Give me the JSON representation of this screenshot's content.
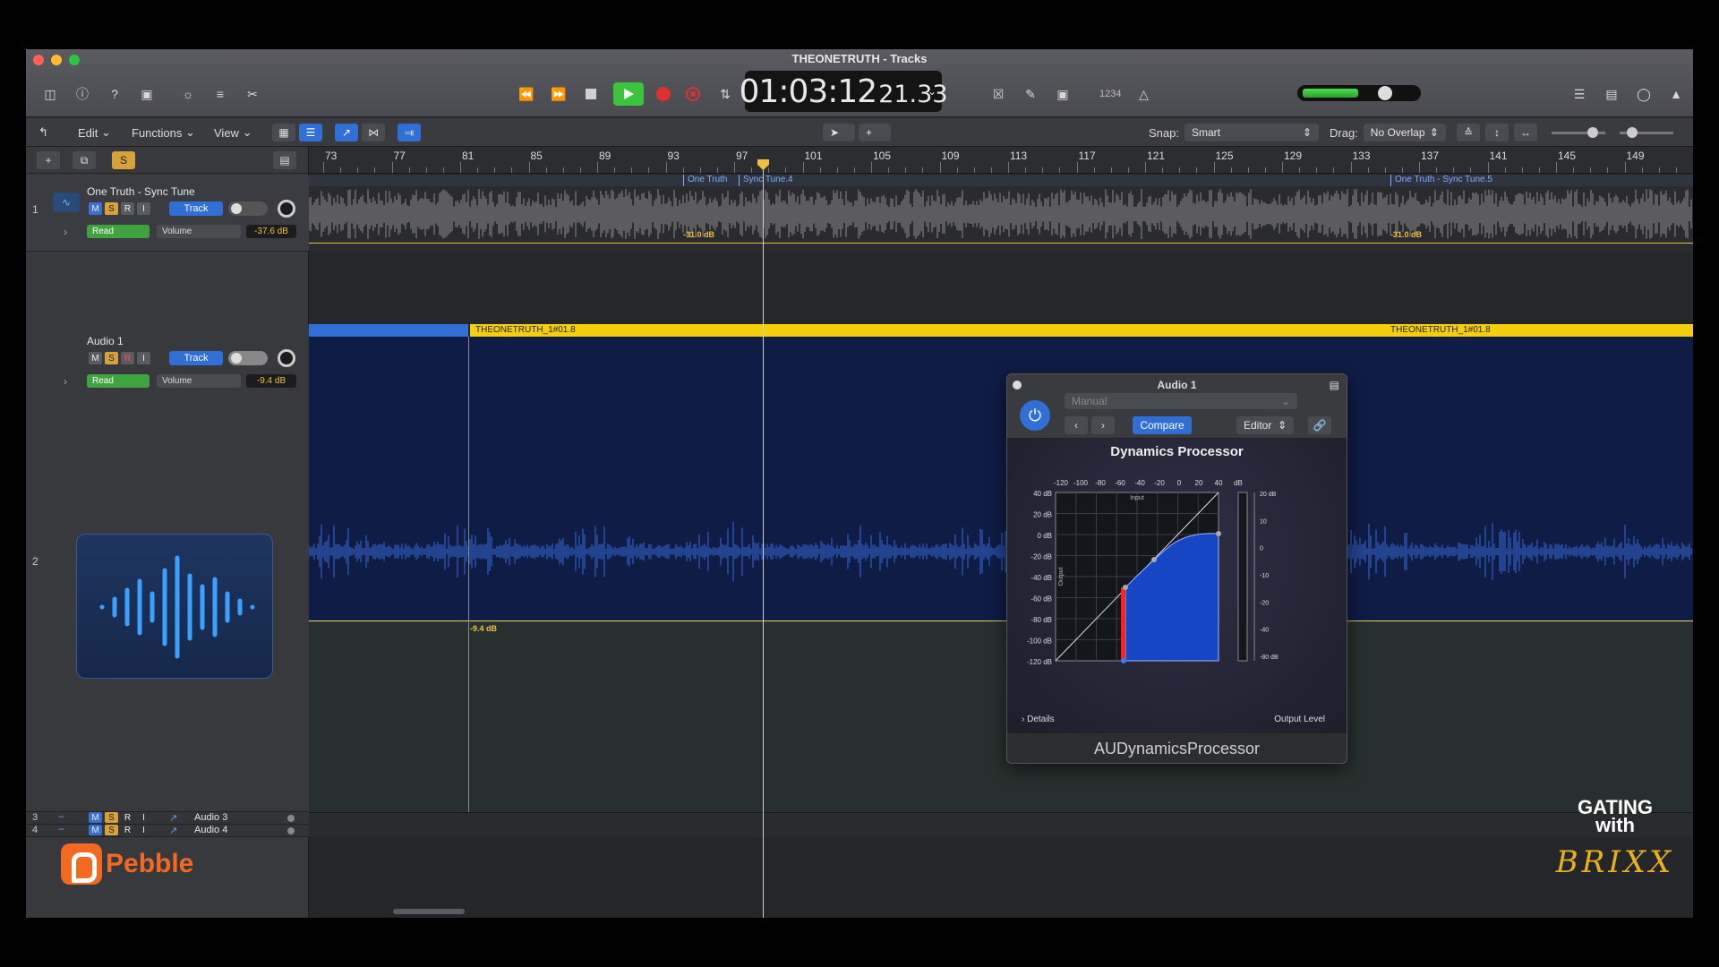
{
  "window": {
    "title": "THEONETRUTH - Tracks",
    "traffic_colors": [
      "#ff5f57",
      "#febc2e",
      "#28c840"
    ]
  },
  "transport": {
    "time_main": "01:03:12",
    "time_frames": "21.33",
    "counter_badge": "1234"
  },
  "toolbar": {
    "edit_label": "Edit",
    "functions_label": "Functions",
    "view_label": "View",
    "snap_label": "Snap:",
    "snap_value": "Smart",
    "drag_label": "Drag:",
    "drag_value": "No Overlap"
  },
  "ruler": {
    "bars": [
      "73",
      "77",
      "81",
      "85",
      "89",
      "93",
      "97",
      "101",
      "105",
      "109",
      "113",
      "117",
      "121",
      "125",
      "129",
      "133",
      "137",
      "141",
      "145",
      "149"
    ]
  },
  "tracks": [
    {
      "number": "1",
      "name": "One Truth - Sync Tune",
      "m": "M",
      "s": "S",
      "r": "R",
      "i": "I",
      "track_btn": "Track",
      "automation_mode": "Read",
      "automation_param": "Volume",
      "db": "-37.6 dB"
    },
    {
      "number": "2",
      "name": "Audio 1",
      "m": "M",
      "s": "S",
      "r": "R",
      "i": "I",
      "track_btn": "Track",
      "automation_mode": "Read",
      "automation_param": "Volume",
      "db": "-9.4 dB"
    }
  ],
  "small_tracks": [
    {
      "number": "3",
      "name": "Audio 3",
      "m": "M",
      "s": "S",
      "r": "R",
      "i": "I"
    },
    {
      "number": "4",
      "name": "Audio 4",
      "m": "M",
      "s": "S",
      "r": "R",
      "i": "I"
    }
  ],
  "lane1": {
    "region_a": "One Truth",
    "region_b": "Sync Tune.4",
    "region_c": "One Truth - Sync Tune.5",
    "db_marker_1": "-31.0 dB",
    "db_marker_2": "-31.0 dB"
  },
  "lane2": {
    "region_label_1": "THEONETRUTH_1#01.8",
    "region_label_2": "THEONETRUTH_1#01.8",
    "automation_db": "-9.4 dB",
    "region_color": "#f5cf0d"
  },
  "sidebar_solo": "S",
  "plugin": {
    "window_title": "Audio 1",
    "preset": "Manual",
    "compare_label": "Compare",
    "editor_label": "Editor",
    "graph_title": "Dynamics Processor",
    "x_ticks": [
      "-120",
      "-100",
      "-80",
      "-60",
      "-40",
      "-20",
      "0",
      "20",
      "40",
      "dB"
    ],
    "y_ticks": [
      "40 dB",
      "20 dB",
      "0 dB",
      "-20 dB",
      "-40 dB",
      "-60 dB",
      "-80 dB",
      "-100 dB",
      "-120 dB"
    ],
    "input_label": "Input",
    "output_label": "Output",
    "meter_ticks": [
      "20 dB",
      "10",
      "0",
      "-10",
      "-20",
      "-40",
      "-80 dB"
    ],
    "details_label": "Details",
    "output_level_label": "Output Level",
    "footer_name": "AUDynamicsProcessor"
  },
  "brand": {
    "logo_text": "Pebble",
    "overlay_line1": "GATING",
    "overlay_line2": "with",
    "overlay_signature": "BRIXX"
  },
  "icons": [
    "library-icon",
    "info-icon",
    "help-icon",
    "browser-icon",
    "smart-controls-icon",
    "mixer-icon",
    "scissors-icon",
    "rewind-icon",
    "fast-forward-icon",
    "stop-icon",
    "play-icon",
    "record-icon",
    "capture-record-icon",
    "cycle-icon",
    "replace-icon",
    "tuner-icon",
    "solo-icon",
    "metronome-icon",
    "list-icon",
    "notepad-icon",
    "loop-browser-icon",
    "media-browser-icon"
  ]
}
